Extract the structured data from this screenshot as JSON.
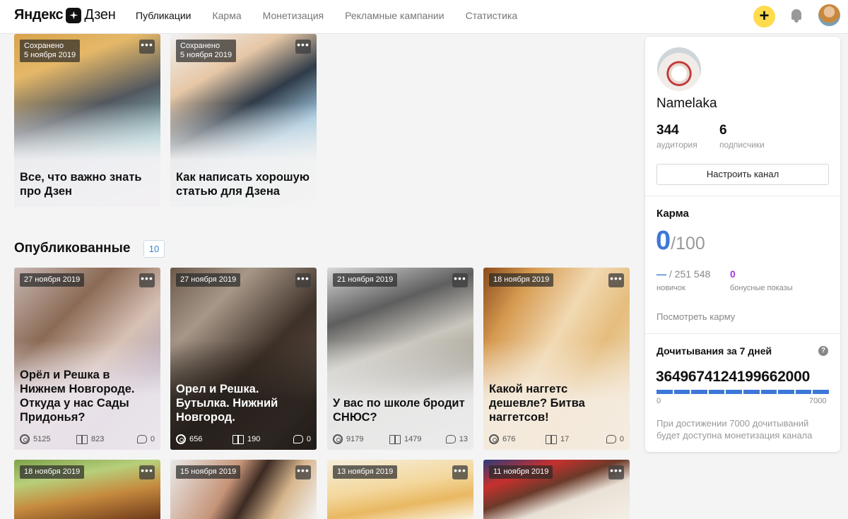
{
  "header": {
    "logo_left": "Яндекс",
    "logo_right": "Дзен",
    "nav": [
      {
        "label": "Публикации",
        "active": true
      },
      {
        "label": "Карма",
        "active": false
      },
      {
        "label": "Монетизация",
        "active": false
      },
      {
        "label": "Рекламные кампании",
        "active": false
      },
      {
        "label": "Статистика",
        "active": false
      }
    ],
    "plus": "+"
  },
  "drafts": [
    {
      "status": "Сохранено",
      "date": "5 ноября 2019",
      "title": "Все, что важно знать про Дзен"
    },
    {
      "status": "Сохранено",
      "date": "5 ноября 2019",
      "title": "Как написать хорошую статью для Дзена"
    }
  ],
  "published": {
    "title": "Опубликованные",
    "count": "10",
    "cards": [
      {
        "date": "27 ноября 2019",
        "title": "Орёл и Решка в Нижнем Новгороде. Откуда у нас Сады Придонья?",
        "views": "5125",
        "reads": "823",
        "comments": "0"
      },
      {
        "date": "27 ноября 2019",
        "title": "Орел и Решка. Бутылка. Нижний Новгород.",
        "views": "656",
        "reads": "190",
        "comments": "0"
      },
      {
        "date": "21 ноября 2019",
        "title": "У вас по школе бродит СНЮС?",
        "views": "9179",
        "reads": "1479",
        "comments": "13"
      },
      {
        "date": "18 ноября 2019",
        "title": "Какой наггетс дешевле? Битва наггетсов!",
        "views": "676",
        "reads": "17",
        "comments": "0"
      }
    ],
    "more": [
      {
        "date": "18 ноября 2019"
      },
      {
        "date": "15 ноября 2019"
      },
      {
        "date": "13 ноября 2019"
      },
      {
        "date": "11 ноября 2019"
      }
    ]
  },
  "sidebar": {
    "channel_name": "Namelaka",
    "audience": {
      "value": "344",
      "label": "аудитория"
    },
    "subscribers": {
      "value": "6",
      "label": "подписчики"
    },
    "configure_button": "Настроить канал",
    "karma": {
      "title": "Карма",
      "value": "0",
      "max": "/100",
      "rank_dash": "—",
      "rank": " / 251 548",
      "rank_label": "новичок",
      "bonus": "0",
      "bonus_label": "бонусные показы",
      "link": "Посмотреть карму"
    },
    "reads": {
      "title": "Дочитывания за 7 дней",
      "value": "3649674124199662000",
      "min": "0",
      "max": "7000",
      "progress": 1.0,
      "note": "При достижении 7000 дочитываний будет доступна монетизация канала"
    }
  }
}
